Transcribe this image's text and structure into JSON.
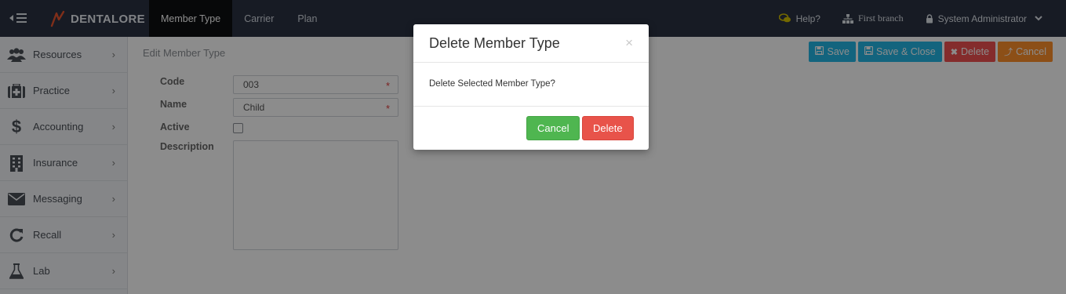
{
  "app": {
    "brand": "DENTALORE"
  },
  "nav": {
    "tabs": [
      {
        "label": "Member Type",
        "active": true
      },
      {
        "label": "Carrier",
        "active": false
      },
      {
        "label": "Plan",
        "active": false
      }
    ],
    "help_label": "Help?",
    "branch_label": "First branch",
    "user_label": "System Administrator"
  },
  "sidebar": {
    "items": [
      {
        "label": "Resources",
        "icon": "users-icon"
      },
      {
        "label": "Practice",
        "icon": "medical-kit-icon"
      },
      {
        "label": "Accounting",
        "icon": "dollar-icon"
      },
      {
        "label": "Insurance",
        "icon": "building-icon"
      },
      {
        "label": "Messaging",
        "icon": "envelope-icon"
      },
      {
        "label": "Recall",
        "icon": "refresh-icon"
      },
      {
        "label": "Lab",
        "icon": "flask-icon"
      }
    ]
  },
  "page": {
    "breadcrumb": "Edit Member Type"
  },
  "toolbar": {
    "save_label": "Save",
    "save_close_label": "Save & Close",
    "delete_label": "Delete",
    "cancel_label": "Cancel"
  },
  "form": {
    "code_label": "Code",
    "code_value": "003",
    "name_label": "Name",
    "name_value": "Child",
    "active_label": "Active",
    "active_checked": false,
    "description_label": "Description",
    "description_value": "",
    "required_marker": "*"
  },
  "modal": {
    "title": "Delete Member Type",
    "close_glyph": "×",
    "message": "Delete Selected Member Type?",
    "cancel_label": "Cancel",
    "delete_label": "Delete"
  },
  "colors": {
    "topbar": "#2a3243",
    "info": "#23b7e5",
    "danger": "#f05050",
    "warning": "#ff902b",
    "success": "#4fb650"
  }
}
